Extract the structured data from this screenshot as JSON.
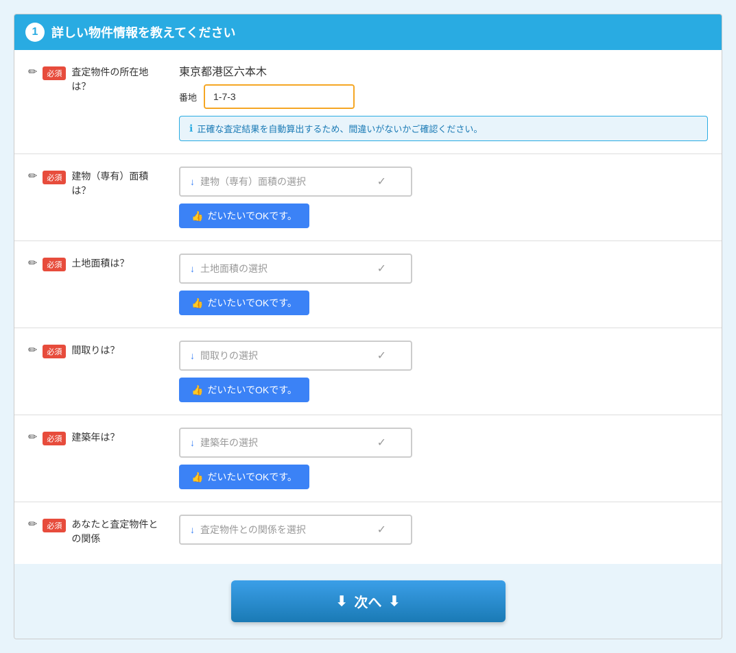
{
  "section": {
    "number": "1",
    "title": "詳しい物件情報を教えてください"
  },
  "fields": [
    {
      "id": "location",
      "label": "査定物件の所在地\nは？",
      "label_line1": "査定物件の所在地",
      "label_line2": "は？",
      "required": true,
      "required_text": "必須",
      "address": "東京都港区六本木",
      "banchi_label": "番地",
      "input_value": "1-7-3",
      "info_text": "正確な査定結果を自動算出するため、間違いがないかご確認ください。"
    },
    {
      "id": "building_area",
      "label_line1": "建物（専有）面積",
      "label_line2": "は？",
      "required": true,
      "required_text": "必須",
      "select_placeholder": "建物（専有）面積の選択",
      "ok_text": "だいたいでOKです。"
    },
    {
      "id": "land_area",
      "label_line1": "土地面積は？",
      "label_line2": "",
      "required": true,
      "required_text": "必須",
      "select_placeholder": "土地面積の選択",
      "ok_text": "だいたいでOKです。"
    },
    {
      "id": "floor_plan",
      "label_line1": "間取りは？",
      "label_line2": "",
      "required": true,
      "required_text": "必須",
      "select_placeholder": "間取りの選択",
      "ok_text": "だいたいでOKです。"
    },
    {
      "id": "build_year",
      "label_line1": "建築年は？",
      "label_line2": "",
      "required": true,
      "required_text": "必須",
      "select_placeholder": "建築年の選択",
      "ok_text": "だいたいでOKです。"
    },
    {
      "id": "relationship",
      "label_line1": "あなたと査定物件と",
      "label_line2": "の関係",
      "required": true,
      "required_text": "必須",
      "select_placeholder": "査定物件との関係を選択"
    }
  ],
  "next_button": {
    "label": "次へ",
    "icon_left": "⬇",
    "icon_right": "⬇"
  },
  "icons": {
    "pencil": "✏",
    "info": "ℹ",
    "thumbs_up": "👍",
    "down_arrow": "↓",
    "check": "✓"
  }
}
